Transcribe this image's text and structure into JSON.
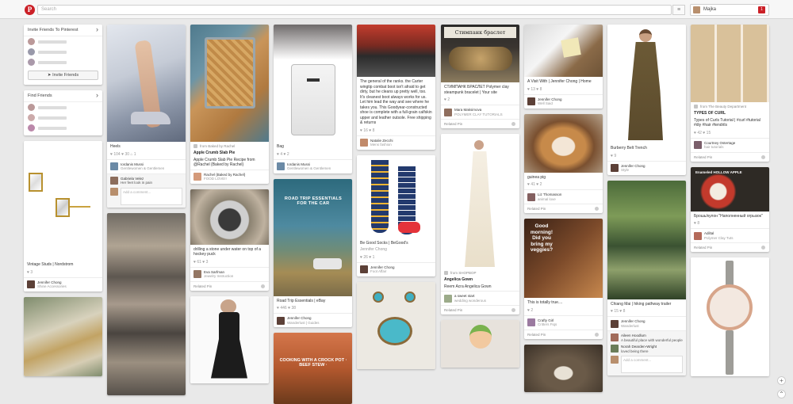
{
  "topbar": {
    "logo": "P",
    "search_placeholder": "Search",
    "menu_glyph": "≡",
    "user_name": "Majka",
    "notifications": "1"
  },
  "sidebar": {
    "invite_title": "Invite Friends To Pinterest",
    "invite_button": "Invite Friends",
    "find_title": "Find Friends"
  },
  "cards": {
    "c1_title": "Vintage Studs | Nordstrom",
    "c1_stats": "♥ 3",
    "c1_user": "Jennifer Chong",
    "c1_board": "Shine Accessories",
    "heels_title": "Heels",
    "heels_stats": "♥ 104  ♥ 30  ⌂ 1",
    "heels_user": "Iordanis Mussi",
    "heels_board": "Gentlewomen & Gentlemen",
    "heels_c_user": "Gabriela Velez",
    "heels_c_text": "Her feet look in pain",
    "heels_add": "Add a comment...",
    "crumb_source": "from Baked by Rachel",
    "crumb_title": "Apple Crumb Slab Pie",
    "crumb_desc": "Apple Crumb Slab Pie Recipe from @Rachel {Baked by Rachel}",
    "crumb_user": "Rachel {Baked by Rachel}",
    "crumb_board": "FOOD LOVE!!",
    "drill_desc": "drilling a stone under water on top of a hockey puck",
    "drill_stats": "♥ 61  ♥ 3",
    "drill_user": "Eva Sarfman",
    "drill_board": "Jewelry Instruction",
    "related": "Related Pin",
    "bag_title": "Bag",
    "bag_stats": "♥ 4  ♥ 2",
    "bag_user": "Iordanis Mussi",
    "bag_board": "Gentlewomen & Gentlemen",
    "road_overlay": "ROAD TRIP ESSENTIALS FOR THE CAR",
    "road_title": "Road Trip Essentials | eBay",
    "road_stats": "♥ 446  ♥ 38",
    "road_user": "Jennifer Chong",
    "road_board": "Wanderlust | Guides",
    "crock_overlay": "COOKING WITH A CROCK POT · BEEF STEW ·",
    "boots_desc": "The general of the ranks. the Carter wingtip combat boot isn't afraid to get dirty, but he cleans up pretty well, too. It's cleanest boot always works for us. Let him lead the way and see where he takes you. This Goodyear-constructed shoe is complete with a full-grain calfskin upper and leather outsole. Free shipping & returns",
    "boots_stats": "♥ 16  ♥ 8",
    "boots_user": "Natalie Zecchi",
    "boots_board": "Mens fashion",
    "socks_title": "Be Good Socks | BeGood's",
    "socks_board_user": "Jennifer Chong",
    "socks_stats": "♥ 26  ♥ 1",
    "socks_user": "Jennifer Chong",
    "socks_board": "Foot Affair",
    "bracelet_overlay": "Стимпанк браслет",
    "bracelet_desc": "СТИМПАНК БРАСЛЕТ Polymer clay steampunk bracelet | Your site",
    "bracelet_stats": "♥ 2",
    "bracelet_user": "Mara Maksimova",
    "bracelet_board": "POLYMER CLAY TUTORIALS",
    "gown_source": "from SHOPBOP",
    "gown_title": "Angelica Gown",
    "gown_desc": "Reem Acra Angelica Gown",
    "gown_user": "a sweet start",
    "gown_board": "wedding wonderous",
    "kb_title": "A Visit With | Jennifer Chong | Home",
    "kb_stats": "♥ 13  ♥ 8",
    "kb_user": "Jennifer Chong",
    "kb_board": "Well Said",
    "pig_desc": "guinea pig",
    "pig_stats": "♥ 41  ♥ 2",
    "pig_user": "Liz Thomasson",
    "pig_board": "animal love",
    "morning_text": "Good morning! Did you bring my veggies?",
    "morning_title": "This is totally true....",
    "morning_stats": "♥ 2",
    "morning_user": "Crafty Girl",
    "morning_board": "Critters Fiqs",
    "trench_title": "Burberry Belt Trench",
    "trench_stats": "♥ 9",
    "trench_user": "Jennifer Chong",
    "trench_board": "Style",
    "forest_title": "Chiang Mai | hiking pathway trailer",
    "forest_stats": "♥ 15  ♥ 8",
    "forest_user": "Jennifer Chong",
    "forest_board": "Wanderlust",
    "forest_c1_user": "Aileen Hoodlum",
    "forest_c1_text": "A beautiful place with wonderful people",
    "forest_c2_user": "Norah Dearden-Wright",
    "forest_c2_text": "loved being there",
    "forest_add": "Add a comment...",
    "curls_source": "from The Beauty Department",
    "curls_header": "TYPES OF CURL",
    "curls_desc": "Types of Curls Tutorial | #curl #tutorial #diy #hair #tendrils",
    "curls_stats": "♥ 42  ♥ 15",
    "curls_user": "Courtney Ostertage",
    "curls_board": "hair tutorials",
    "apple_overlay": "Enameled HOLLOW APPLE",
    "apple_desc": "Брошь/кулон \"Наполненный огрызок\"",
    "apple_stats": "♥ 8",
    "apple_user": "Adiltal",
    "apple_board": "Polymer Clay Tuts"
  },
  "side_buttons": {
    "add": "+",
    "up": "⌃"
  }
}
